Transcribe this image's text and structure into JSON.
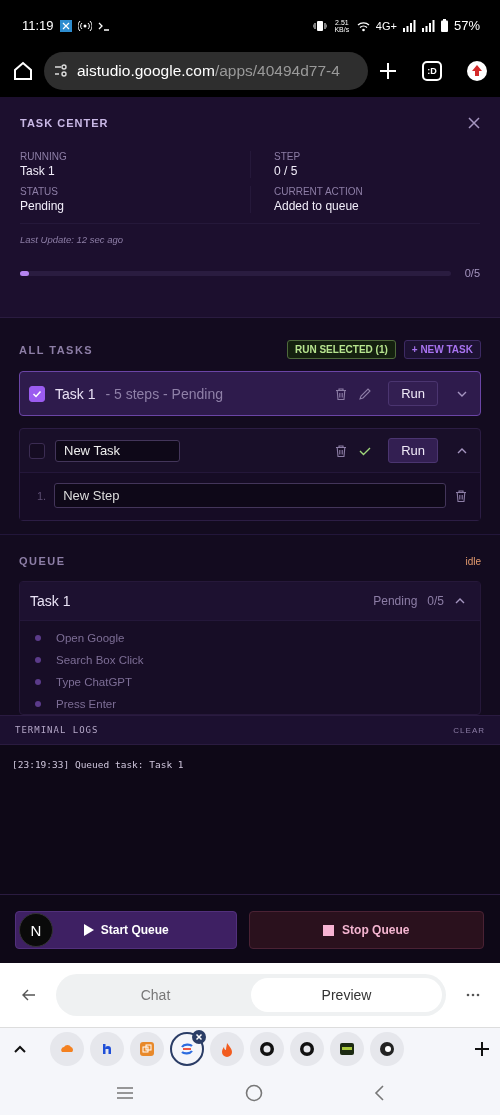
{
  "status_bar": {
    "time": "11:19",
    "speed": "2.51 KB/s",
    "network": "4G+",
    "battery": "57%"
  },
  "browser": {
    "url_host": "aistudio.google.com",
    "url_path": "/apps/40494d77-4",
    "tab_count": ":D"
  },
  "task_center": {
    "title": "TASK CENTER",
    "fields": [
      {
        "label": "RUNNING",
        "value": "Task 1"
      },
      {
        "label": "STEP",
        "value": "0 / 5"
      },
      {
        "label": "STATUS",
        "value": "Pending"
      },
      {
        "label": "CURRENT ACTION",
        "value": "Added to queue"
      }
    ],
    "last_update": "Last Update: 12 sec ago",
    "progress": {
      "level": 0.02,
      "reading": "0/5"
    }
  },
  "all_tasks": {
    "title": "ALL TASKS",
    "run_selected": "RUN SELECTED (1)",
    "new_task": "+ NEW TASK",
    "tasks": [
      {
        "kind": "view",
        "checked": true,
        "name": "Task 1",
        "meta": "- 5 steps - Pending",
        "run": "Run",
        "expanded": false
      },
      {
        "kind": "edit",
        "checked": false,
        "name": "New Task",
        "run": "Run",
        "expanded": true,
        "steps": [
          {
            "number": "1.",
            "text": "New Step"
          }
        ]
      }
    ]
  },
  "queue": {
    "title": "QUEUE",
    "state": "idle",
    "items": [
      {
        "name": "Task 1",
        "status": "Pending",
        "progress": "0/5",
        "expanded": true,
        "steps": [
          "Open Google",
          "Search Box Click",
          "Type ChatGPT",
          "Press Enter"
        ]
      }
    ]
  },
  "terminal": {
    "title": "TERMINAL LOGS",
    "clear": "CLEAR",
    "lines": [
      "[23:19:33] Queued task: Task 1"
    ]
  },
  "controls": {
    "avatar": "N",
    "start": "Start Queue",
    "stop": "Stop Queue"
  },
  "app_nav": {
    "tabs": [
      {
        "label": "Chat",
        "selected": false
      },
      {
        "label": "Preview",
        "selected": true
      }
    ]
  },
  "browser_tabs": [
    {
      "selected": false
    },
    {
      "selected": false
    },
    {
      "selected": false
    },
    {
      "selected": true
    },
    {
      "selected": false
    },
    {
      "selected": false
    },
    {
      "selected": false
    },
    {
      "selected": false
    },
    {
      "selected": false
    }
  ]
}
